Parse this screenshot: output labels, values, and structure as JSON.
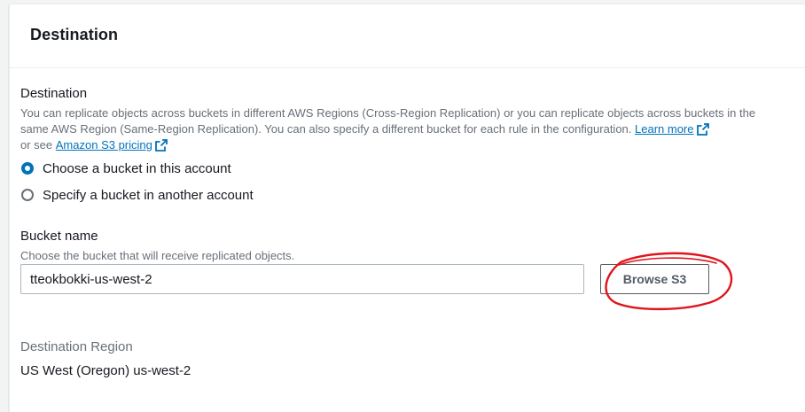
{
  "panel": {
    "title": "Destination"
  },
  "destination": {
    "label": "Destination",
    "description_part1": "You can replicate objects across buckets in different AWS Regions (Cross-Region Replication) or you can replicate objects across buckets in the same AWS Region (Same-Region Replication). You can also specify a different bucket for each rule in the configuration.",
    "learn_more": "Learn more",
    "or_see": "or see",
    "pricing_link": "Amazon S3 pricing",
    "options": [
      {
        "label": "Choose a bucket in this account",
        "selected": true
      },
      {
        "label": "Specify a bucket in another account",
        "selected": false
      }
    ]
  },
  "bucket": {
    "label": "Bucket name",
    "description": "Choose the bucket that will receive replicated objects.",
    "value": "tteokbokki-us-west-2",
    "browse_label": "Browse S3"
  },
  "region": {
    "label": "Destination Region",
    "value": "US West (Oregon) us-west-2"
  },
  "icons": {
    "external_link": "external-link-icon",
    "annotation": "red-hand-drawn-circle"
  },
  "colors": {
    "link": "#0073bb",
    "radio_selected": "#0073bb",
    "annotation": "#e0141c",
    "muted_text": "#687078"
  }
}
